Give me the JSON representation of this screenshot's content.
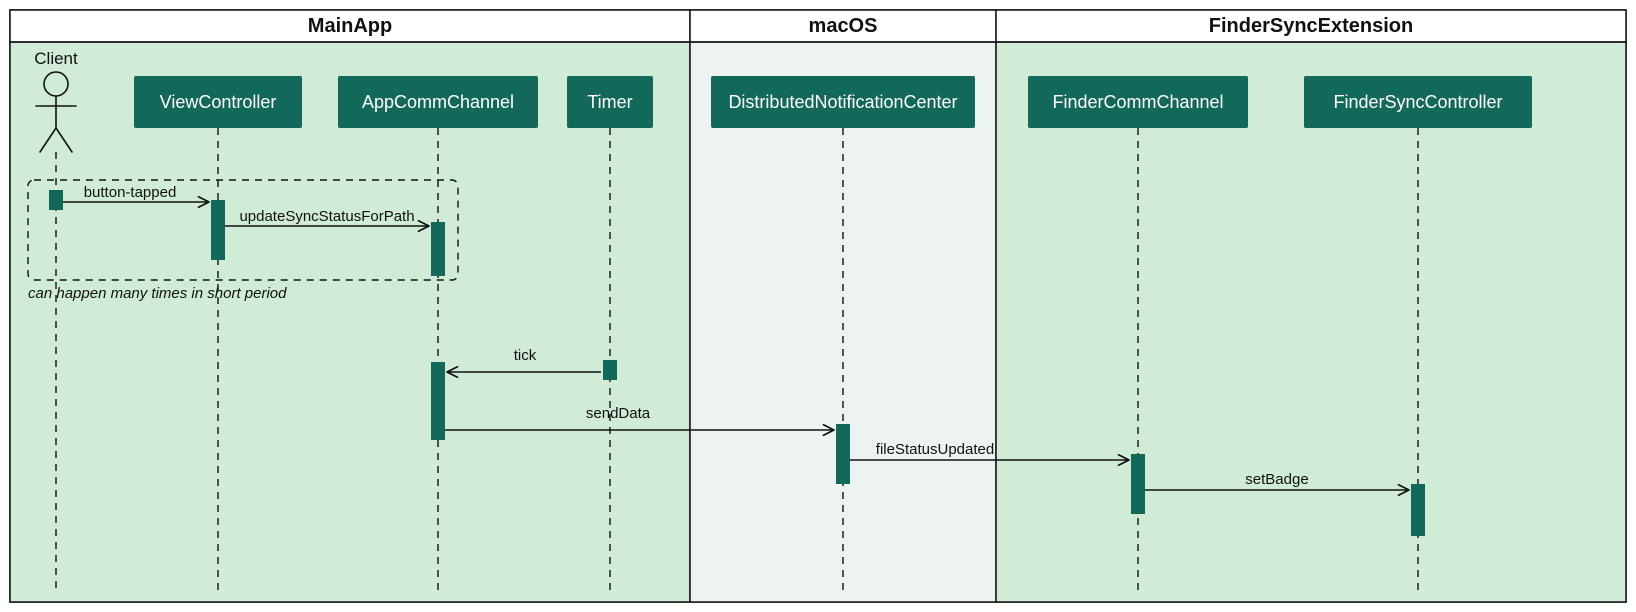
{
  "chart_data": {
    "type": "sequence_diagram",
    "lanes": [
      {
        "id": "MainApp",
        "title": "MainApp"
      },
      {
        "id": "macOS",
        "title": "macOS"
      },
      {
        "id": "FinderSyncExtension",
        "title": "FinderSyncExtension"
      }
    ],
    "actor": {
      "name": "Client",
      "lane": "MainApp"
    },
    "participants": [
      {
        "id": "ViewController",
        "label": "ViewController",
        "lane": "MainApp"
      },
      {
        "id": "AppCommChannel",
        "label": "AppCommChannel",
        "lane": "MainApp"
      },
      {
        "id": "Timer",
        "label": "Timer",
        "lane": "MainApp"
      },
      {
        "id": "DistributedNotificationCenter",
        "label": "DistributedNotificationCenter",
        "lane": "macOS"
      },
      {
        "id": "FinderCommChannel",
        "label": "FinderCommChannel",
        "lane": "FinderSyncExtension"
      },
      {
        "id": "FinderSyncController",
        "label": "FinderSyncController",
        "lane": "FinderSyncExtension"
      }
    ],
    "messages": [
      {
        "from": "Client",
        "to": "ViewController",
        "label": "button-tapped"
      },
      {
        "from": "ViewController",
        "to": "AppCommChannel",
        "label": "updateSyncStatusForPath"
      },
      {
        "from": "Timer",
        "to": "AppCommChannel",
        "label": "tick"
      },
      {
        "from": "AppCommChannel",
        "to": "DistributedNotificationCenter",
        "label": "sendData"
      },
      {
        "from": "DistributedNotificationCenter",
        "to": "FinderCommChannel",
        "label": "fileStatusUpdated"
      },
      {
        "from": "FinderCommChannel",
        "to": "FinderSyncController",
        "label": "setBadge"
      }
    ],
    "fragment": {
      "covers": [
        "Client",
        "ViewController",
        "AppCommChannel"
      ],
      "messages": [
        "button-tapped",
        "updateSyncStatusForPath"
      ],
      "note": "can happen many times in short period"
    }
  },
  "colors": {
    "laneGreen": "#d0ecd7",
    "laneGrey": "#edf3f1",
    "participant": "#12695a",
    "border": "#111111"
  }
}
